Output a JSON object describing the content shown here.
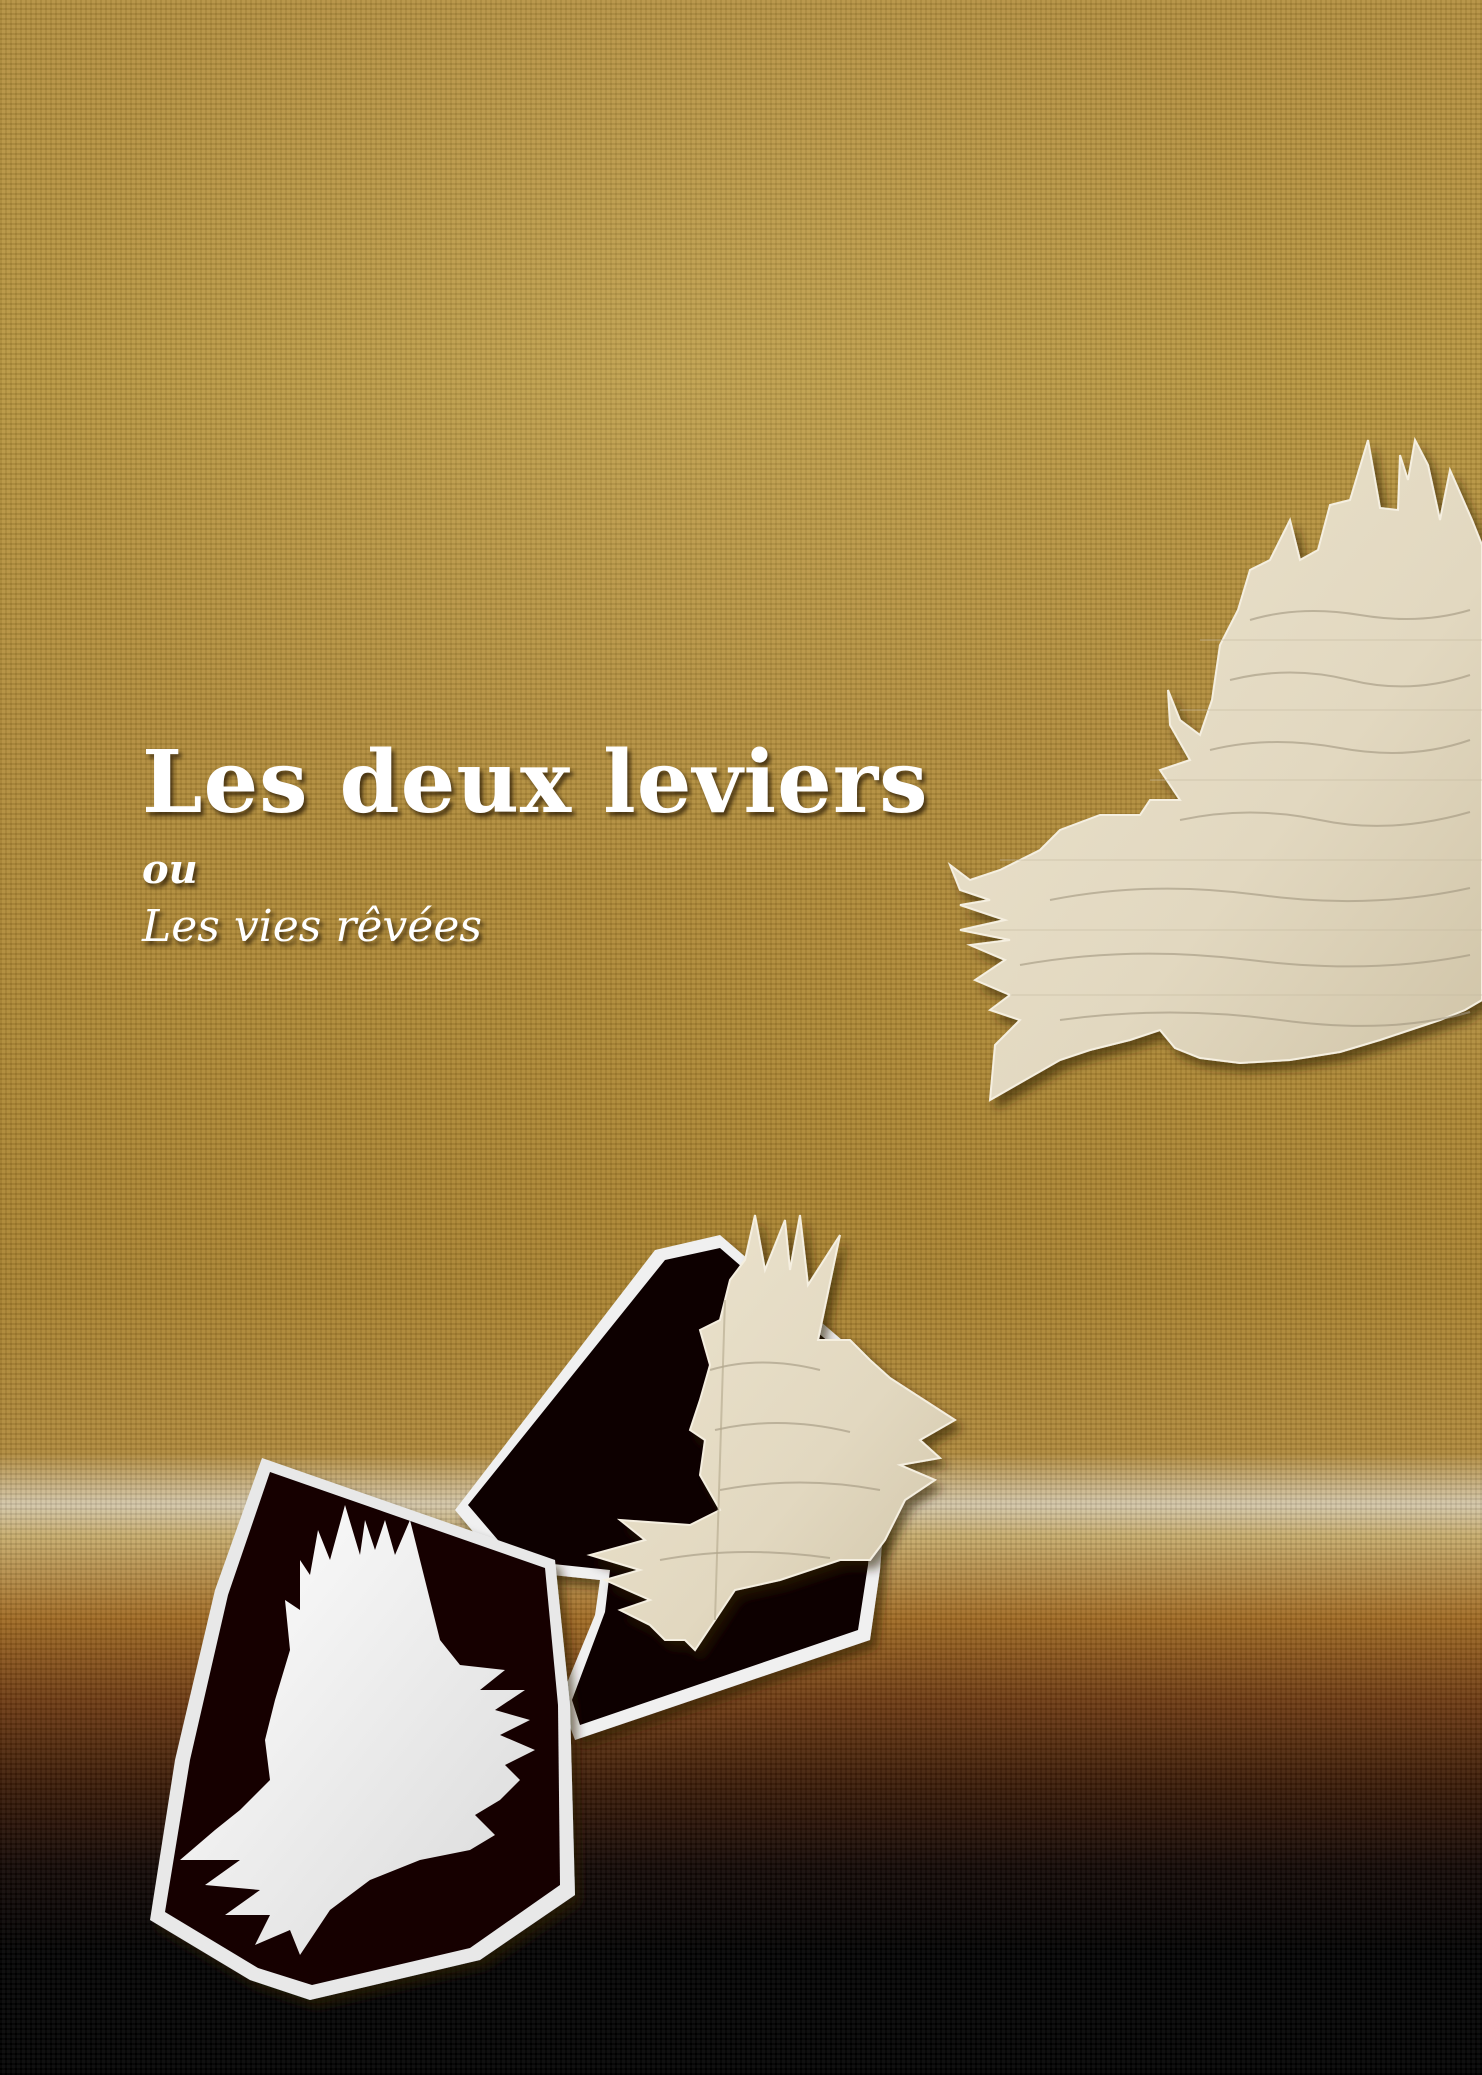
{
  "cover": {
    "title": "Les deux leviers",
    "connector": "ou",
    "subtitle": "Les vies rêvées"
  },
  "colors": {
    "fabric": "#b48f3e",
    "paper": "#e6ddc8",
    "dark_shape": "#120404",
    "text": "#ffffff"
  }
}
